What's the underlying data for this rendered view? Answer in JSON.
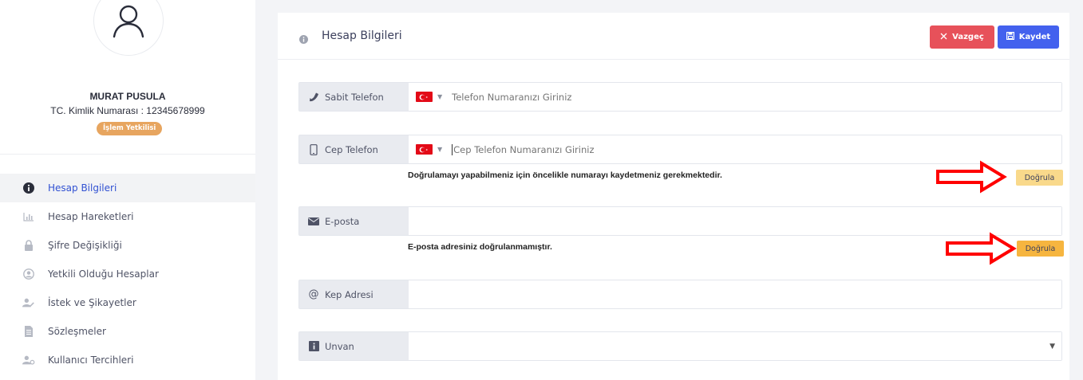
{
  "sidebar": {
    "user": {
      "name": "MURAT PUSULA",
      "tc_label": "TC. Kimlik Numarası : 12345678999",
      "role_badge": "İşlem Yetkilisi"
    },
    "menu": [
      {
        "label": "Hesap Bilgileri",
        "icon": "info-icon",
        "active": true
      },
      {
        "label": "Hesap Hareketleri",
        "icon": "bar-chart-icon",
        "active": false
      },
      {
        "label": "Şifre Değişikliği",
        "icon": "lock-icon",
        "active": false
      },
      {
        "label": "Yetkili Olduğu Hesaplar",
        "icon": "user-circle-icon",
        "active": false
      },
      {
        "label": "İstek ve Şikayetler",
        "icon": "user-edit-icon",
        "active": false
      },
      {
        "label": "Sözleşmeler",
        "icon": "document-icon",
        "active": false
      },
      {
        "label": "Kullanıcı Tercihleri",
        "icon": "user-settings-icon",
        "active": false
      }
    ]
  },
  "panel": {
    "title": "Hesap Bilgileri",
    "cancel_label": "Vazgeç",
    "save_label": "Kaydet"
  },
  "form": {
    "landline": {
      "label": "Sabit Telefon",
      "placeholder": "Telefon Numaranızı Giriniz",
      "country": "TR"
    },
    "mobile": {
      "label": "Cep Telefon",
      "placeholder": "Cep Telefon Numaranızı Giriniz",
      "country": "TR",
      "note": "Doğrulamayı yapabilmeniz için öncelikle numarayı kaydetmeniz gerekmektedir.",
      "verify_label": "Doğrula"
    },
    "email": {
      "label": "E-posta",
      "value": "",
      "note": "E-posta adresiniz doğrulanmamıştır.",
      "verify_label": "Doğrula"
    },
    "kep": {
      "label": "Kep Adresi",
      "value": ""
    },
    "title_select": {
      "label": "Unvan",
      "selected": ""
    }
  },
  "colors": {
    "accent": "#4361ee",
    "danger": "#e7515a",
    "warning": "#f6b53f",
    "warning_light": "#f9d98b",
    "badge": "#e7a55f",
    "annotation_arrow": "#ff0000"
  }
}
